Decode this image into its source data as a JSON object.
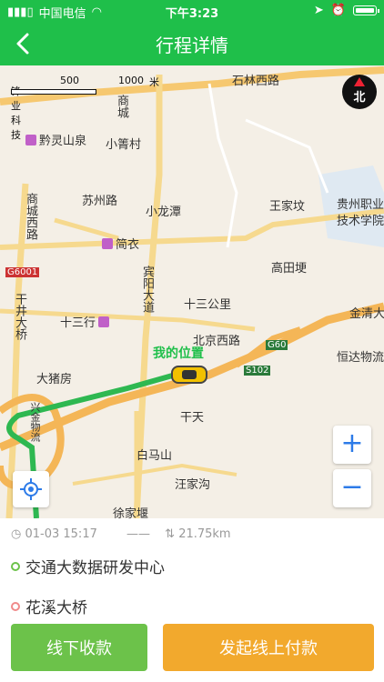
{
  "statusbar": {
    "carrier": "中国电信",
    "time": "下午3:23"
  },
  "nav": {
    "title": "行程详情"
  },
  "map": {
    "scale": {
      "label_a": "500",
      "label_b": "1000",
      "unit": "米",
      "obscured": "锋业科技"
    },
    "compass": "北",
    "labels": {
      "shilin": "石林西路",
      "shangcheng": "商城",
      "qianling": "黔灵山泉",
      "xiaoguan": "小箐村",
      "suzhou": "苏州路",
      "xiaolongtan": "小龙潭",
      "wangjia": "王家坟",
      "guizhou1": "贵州职业",
      "guizhou2": "技术学院",
      "shangchengxi": "商城西路",
      "jianyi": "简衣",
      "baoyang": "宾阳大道",
      "gaotian": "高田埂",
      "g6001": "G6001",
      "shisangongli": "十三公里",
      "jinqing": "金清大",
      "qianjing": "干井大桥",
      "shisanhang": "十三行",
      "beijing": "北京西路",
      "g60": "G60",
      "hengda": "恒达物流",
      "dazhufang": "大猪房",
      "s102": "S102",
      "gantian": "干天",
      "baimashan": "白马山",
      "wangjiagou": "汪家沟",
      "xujiaqu": "徐家堰",
      "shuangfeng": "兴金物流"
    },
    "my_location": "我的位置"
  },
  "trip": {
    "datetime": "01-03 15:17",
    "separator": "——",
    "distance": "21.75km",
    "start": "交通大数据研发中心",
    "end": "花溪大桥",
    "start_color": "#6cc24a",
    "end_color": "#f08a8a"
  },
  "buttons": {
    "offline": "线下收款",
    "online": "发起线上付款"
  },
  "colors": {
    "brand": "#1fbf4a",
    "offline_btn": "#6cc24a",
    "online_btn": "#f2a92d",
    "route": "#2eb851"
  }
}
